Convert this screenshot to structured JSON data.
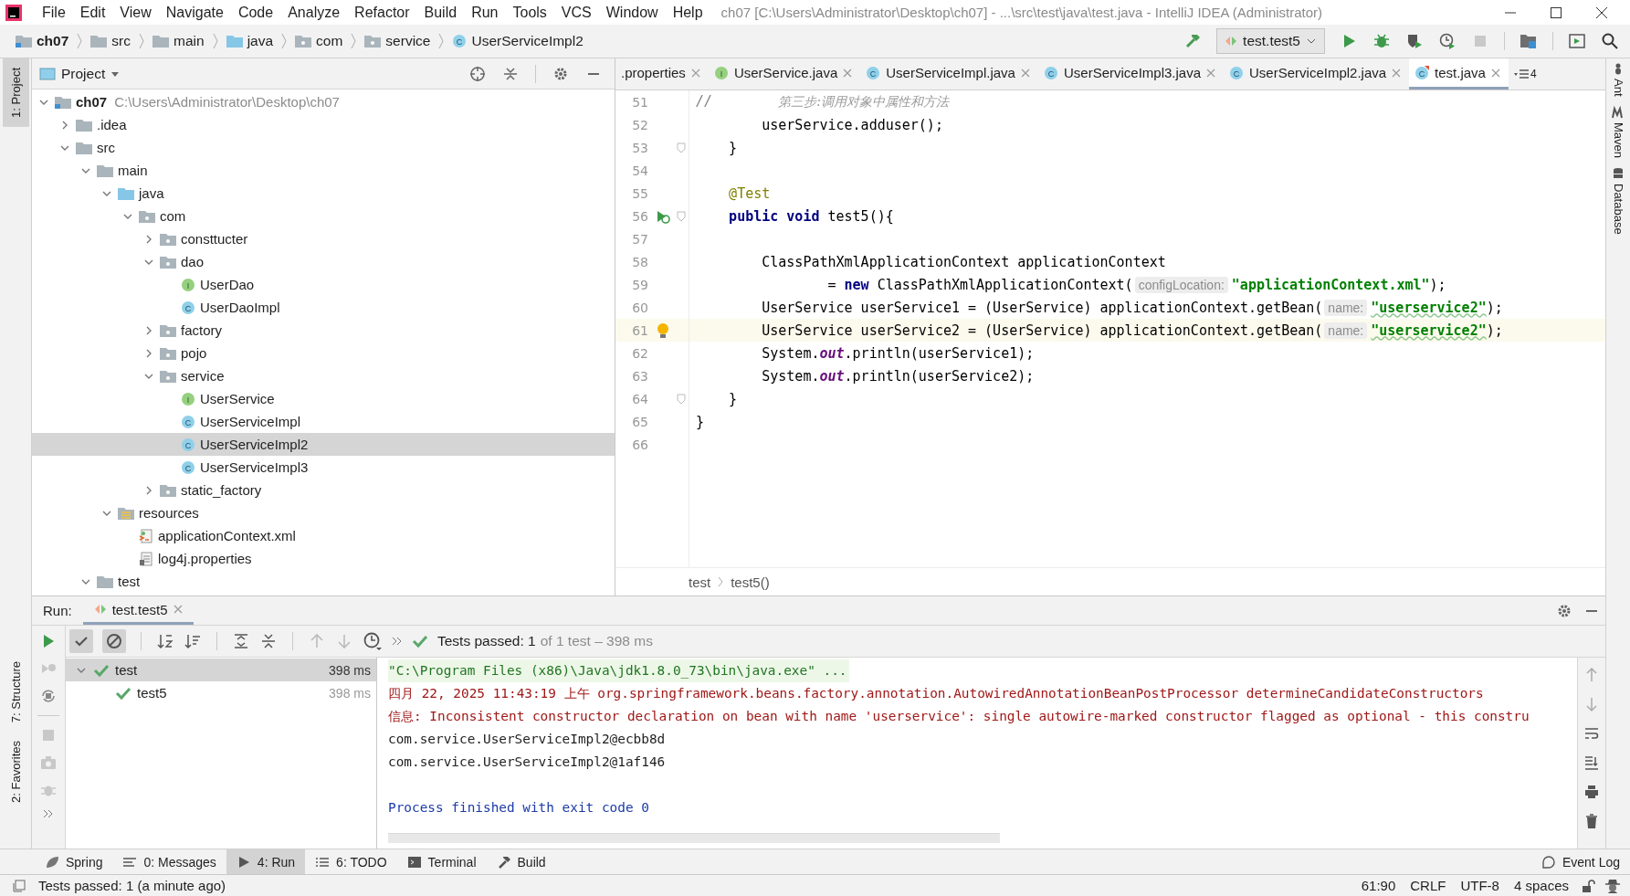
{
  "window": {
    "title": "ch07 [C:\\Users\\Administrator\\Desktop\\ch07] - ...\\src\\test\\java\\test.java - IntelliJ IDEA (Administrator)"
  },
  "menu": [
    "File",
    "Edit",
    "View",
    "Navigate",
    "Code",
    "Analyze",
    "Refactor",
    "Build",
    "Run",
    "Tools",
    "VCS",
    "Window",
    "Help"
  ],
  "nav_breadcrumbs": [
    {
      "label": "ch07",
      "kind": "module"
    },
    {
      "label": "src",
      "kind": "folder"
    },
    {
      "label": "main",
      "kind": "folder"
    },
    {
      "label": "java",
      "kind": "source_folder"
    },
    {
      "label": "com",
      "kind": "package"
    },
    {
      "label": "service",
      "kind": "package"
    },
    {
      "label": "UserServiceImpl2",
      "kind": "class",
      "icon_letter": "C"
    }
  ],
  "run_configuration": "test.test5",
  "left_strip": [
    {
      "label": "1: Project",
      "selected": true
    },
    {
      "label": "7: Structure",
      "selected": false
    },
    {
      "label": "2: Favorites",
      "selected": false
    }
  ],
  "right_strip": [
    {
      "label": "Ant",
      "kind": "ant"
    },
    {
      "label": "Maven",
      "kind": "maven"
    },
    {
      "label": "Database",
      "kind": "database"
    }
  ],
  "project_panel": {
    "title": "Project"
  },
  "project_tree": [
    {
      "label": "ch07",
      "hint": "C:\\Users\\Administrator\\Desktop\\ch07",
      "kind": "module",
      "expanded": true,
      "selected": false,
      "children": [
        {
          "label": ".idea",
          "kind": "folder",
          "expanded": false,
          "selected": false
        },
        {
          "label": "src",
          "kind": "folder",
          "expanded": true,
          "selected": false,
          "children": [
            {
              "label": "main",
              "kind": "folder",
              "expanded": true,
              "selected": false,
              "children": [
                {
                  "label": "java",
                  "kind": "source_folder",
                  "expanded": true,
                  "selected": false,
                  "children": [
                    {
                      "label": "com",
                      "kind": "package",
                      "expanded": true,
                      "selected": false,
                      "children": [
                        {
                          "label": "consttucter",
                          "kind": "package",
                          "expanded": false,
                          "selected": false
                        },
                        {
                          "label": "dao",
                          "kind": "package",
                          "expanded": true,
                          "selected": false,
                          "children": [
                            {
                              "label": "UserDao",
                              "kind": "interface",
                              "icon_letter": "I",
                              "selected": false
                            },
                            {
                              "label": "UserDaoImpl",
                              "kind": "class",
                              "icon_letter": "C",
                              "selected": false
                            }
                          ]
                        },
                        {
                          "label": "factory",
                          "kind": "package",
                          "expanded": false,
                          "selected": false
                        },
                        {
                          "label": "pojo",
                          "kind": "package",
                          "expanded": false,
                          "selected": false
                        },
                        {
                          "label": "service",
                          "kind": "package",
                          "expanded": true,
                          "selected": false,
                          "children": [
                            {
                              "label": "UserService",
                              "kind": "interface",
                              "icon_letter": "I",
                              "selected": false
                            },
                            {
                              "label": "UserServiceImpl",
                              "kind": "class",
                              "icon_letter": "C",
                              "selected": false
                            },
                            {
                              "label": "UserServiceImpl2",
                              "kind": "class",
                              "icon_letter": "C",
                              "selected": true
                            },
                            {
                              "label": "UserServiceImpl3",
                              "kind": "class",
                              "icon_letter": "C",
                              "selected": false
                            }
                          ]
                        },
                        {
                          "label": "static_factory",
                          "kind": "package",
                          "expanded": false,
                          "selected": false
                        }
                      ]
                    }
                  ]
                },
                {
                  "label": "resources",
                  "kind": "resources",
                  "expanded": true,
                  "selected": false,
                  "children": [
                    {
                      "label": "applicationContext.xml",
                      "kind": "xml",
                      "selected": false
                    },
                    {
                      "label": "log4j.properties",
                      "kind": "properties",
                      "selected": false
                    }
                  ]
                }
              ]
            },
            {
              "label": "test",
              "kind": "folder",
              "expanded": true,
              "selected": false
            }
          ]
        }
      ]
    }
  ],
  "editor_tabs": [
    {
      "label": ".properties",
      "selected": false
    },
    {
      "label": "UserService.java",
      "kind": "interface",
      "icon_letter": "I",
      "selected": false
    },
    {
      "label": "UserServiceImpl.java",
      "kind": "class",
      "icon_letter": "C",
      "selected": false
    },
    {
      "label": "UserServiceImpl3.java",
      "kind": "class",
      "icon_letter": "C",
      "selected": false
    },
    {
      "label": "UserServiceImpl2.java",
      "kind": "class",
      "icon_letter": "C",
      "selected": false
    },
    {
      "label": "test.java",
      "kind": "test_class",
      "icon_letter": "C",
      "selected": true
    }
  ],
  "tab_overflow_count": "4",
  "code_lines": [
    {
      "number": "51",
      "current": false,
      "fold": false,
      "tokens": [
        {
          "kind": "comment",
          "text": "//        "
        },
        {
          "kind": "cjk_comment",
          "text": "第三步:调用对象中属性和方法"
        }
      ]
    },
    {
      "number": "52",
      "current": false,
      "fold": false,
      "tokens": [
        {
          "kind": "plain",
          "text": "        userService.adduser();"
        }
      ]
    },
    {
      "number": "53",
      "current": false,
      "fold": true,
      "tokens": [
        {
          "kind": "plain",
          "text": "    }"
        }
      ]
    },
    {
      "number": "54",
      "current": false,
      "fold": false
    },
    {
      "number": "55",
      "current": false,
      "fold": false,
      "tokens": [
        {
          "kind": "annotation",
          "text": "    @Test"
        }
      ]
    },
    {
      "number": "56",
      "current": false,
      "fold": true,
      "kind": "run",
      "tokens": [
        {
          "kind": "keyword",
          "text": "    public void"
        },
        {
          "kind": "plain",
          "text": " test5(){"
        }
      ]
    },
    {
      "number": "57",
      "current": false,
      "fold": false
    },
    {
      "number": "58",
      "current": false,
      "fold": false,
      "tokens": [
        {
          "kind": "plain",
          "text": "        ClassPathXmlApplicationContext applicationContext"
        }
      ]
    },
    {
      "number": "59",
      "current": false,
      "fold": false,
      "tokens": [
        {
          "kind": "plain",
          "text": "                = "
        },
        {
          "kind": "keyword",
          "text": "new"
        },
        {
          "kind": "plain",
          "text": " ClassPathXmlApplicationContext("
        },
        {
          "kind": "hint",
          "text": "configLocation:"
        },
        {
          "kind": "string",
          "text": "\"applicationContext.xml\""
        },
        {
          "kind": "plain",
          "text": ");"
        }
      ]
    },
    {
      "number": "60",
      "current": false,
      "fold": false,
      "tokens": [
        {
          "kind": "plain",
          "text": "        UserService userService1 = (UserService) applicationContext.getBean("
        },
        {
          "kind": "hint",
          "text": "name:"
        },
        {
          "kind": "string_typo",
          "text": "\"userservice2\""
        },
        {
          "kind": "plain",
          "text": ");"
        }
      ]
    },
    {
      "number": "61",
      "current": true,
      "fold": false,
      "kind": "bulb",
      "tokens": [
        {
          "kind": "plain",
          "text": "        UserService userService2 = (UserService) applicationContext.getBean("
        },
        {
          "kind": "hint",
          "text": "name:"
        },
        {
          "kind": "string_typo",
          "text": "\"userservice2\""
        },
        {
          "kind": "plain",
          "text": ");"
        }
      ]
    },
    {
      "number": "62",
      "current": false,
      "fold": false,
      "tokens": [
        {
          "kind": "plain",
          "text": "        System."
        },
        {
          "kind": "static",
          "text": "out"
        },
        {
          "kind": "plain",
          "text": ".println(userService1);"
        }
      ]
    },
    {
      "number": "63",
      "current": false,
      "fold": false,
      "tokens": [
        {
          "kind": "plain",
          "text": "        System."
        },
        {
          "kind": "static",
          "text": "out"
        },
        {
          "kind": "plain",
          "text": ".println(userService2);"
        }
      ]
    },
    {
      "number": "64",
      "current": false,
      "fold": true,
      "tokens": [
        {
          "kind": "plain",
          "text": "    }"
        }
      ]
    },
    {
      "number": "65",
      "current": false,
      "fold": false,
      "tokens": [
        {
          "kind": "plain",
          "text": "}"
        }
      ]
    },
    {
      "number": "66",
      "current": false,
      "fold": false
    }
  ],
  "editor_breadcrumbs": [
    "test",
    "test5()"
  ],
  "run_panel": {
    "label": "Run:",
    "tab": "test.test5",
    "summary_main": "Tests passed: 1",
    "summary_detail": "of 1 test – 398 ms",
    "show_passed": true,
    "show_ignored": true
  },
  "test_tree": [
    {
      "label": "test",
      "time": "398 ms",
      "passed": true,
      "expanded": true,
      "selected": true,
      "children": [
        {
          "label": "test5",
          "time": "398 ms",
          "passed": true,
          "selected": false
        }
      ]
    }
  ],
  "console_lines": [
    {
      "kind": "command",
      "text": "\"C:\\Program Files (x86)\\Java\\jdk1.8.0_73\\bin\\java.exe\" ..."
    },
    {
      "kind": "error",
      "text": "四月 22, 2025 11:43:19 上午 org.springframework.beans.factory.annotation.AutowiredAnnotationBeanPostProcessor determineCandidateConstructors"
    },
    {
      "kind": "error",
      "text": "信息: Inconsistent constructor declaration on bean with name 'userservice': single autowire-marked constructor flagged as optional - this constru"
    },
    {
      "kind": "output",
      "text": "com.service.UserServiceImpl2@ecbb8d"
    },
    {
      "kind": "output",
      "text": "com.service.UserServiceImpl2@1af146"
    },
    {
      "kind": "exit",
      "text": "Process finished with exit code 0"
    }
  ],
  "tool_windows": [
    {
      "label": "Spring",
      "kind": "leaf",
      "selected": false
    },
    {
      "label": "0: Messages",
      "kind": "lines",
      "selected": false
    },
    {
      "label": "4: Run",
      "kind": "play",
      "selected": true
    },
    {
      "label": "6: TODO",
      "kind": "list",
      "selected": false
    },
    {
      "label": "Terminal",
      "kind": "terminal",
      "selected": false
    },
    {
      "label": "Build",
      "kind": "hammer",
      "selected": false
    }
  ],
  "event_log": "Event Log",
  "status_bar": {
    "message": "Tests passed: 1 (a minute ago)",
    "position": "61:90",
    "line_separator": "CRLF",
    "encoding": "UTF-8",
    "indent": "4 spaces"
  }
}
